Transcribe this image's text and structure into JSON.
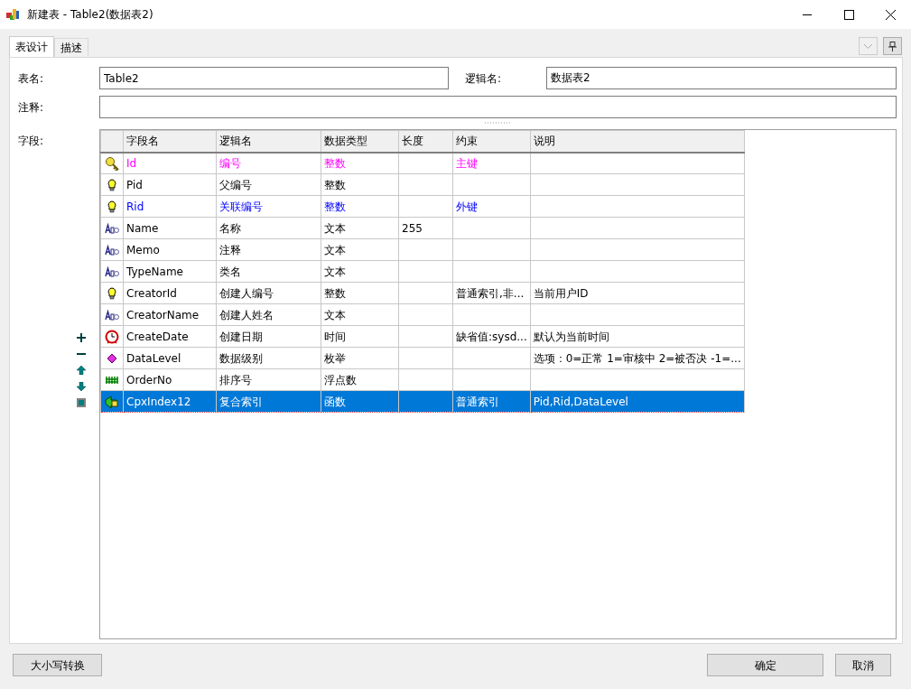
{
  "window": {
    "title": "新建表 - Table2(数据表2)"
  },
  "tabs": [
    {
      "label": "表设计",
      "selected": true
    },
    {
      "label": "描述",
      "selected": false
    }
  ],
  "form": {
    "table_name_label": "表名:",
    "table_name": "Table2",
    "logical_name_label": "逻辑名:",
    "logical_name": "数据表2",
    "comment_label": "注释:",
    "fields_label": "字段:"
  },
  "grid": {
    "columns": [
      "字段名",
      "逻辑名",
      "数据类型",
      "长度",
      "约束",
      "说明"
    ],
    "rows": [
      {
        "kind": "key",
        "color": "#ff00ff",
        "selected": false,
        "name": "Id",
        "logical": "编号",
        "type": "整数",
        "constraint": "主键"
      },
      {
        "kind": "bulb",
        "color": "#000000",
        "selected": false,
        "name": "Pid",
        "logical": "父编号",
        "type": "整数"
      },
      {
        "kind": "bulb",
        "color": "#0000ff",
        "selected": false,
        "name": "Rid",
        "logical": "关联编号",
        "type": "整数",
        "constraint": "外键"
      },
      {
        "kind": "text",
        "color": "#000000",
        "selected": false,
        "name": "Name",
        "logical": "名称",
        "type": "文本",
        "length": "255"
      },
      {
        "kind": "text",
        "color": "#000000",
        "selected": false,
        "name": "Memo",
        "logical": "注释",
        "type": "文本"
      },
      {
        "kind": "text",
        "color": "#000000",
        "selected": false,
        "name": "TypeName",
        "logical": "类名",
        "type": "文本"
      },
      {
        "kind": "bulb",
        "color": "#000000",
        "selected": false,
        "name": "CreatorId",
        "logical": "创建人编号",
        "type": "整数",
        "constraint": "普通索引,非...",
        "description": "当前用户ID"
      },
      {
        "kind": "text",
        "color": "#000000",
        "selected": false,
        "name": "CreatorName",
        "logical": "创建人姓名",
        "type": "文本"
      },
      {
        "kind": "clock",
        "color": "#000000",
        "selected": false,
        "name": "CreateDate",
        "logical": "创建日期",
        "type": "时间",
        "constraint": "缺省值:sysd...",
        "description": "默认为当前时间"
      },
      {
        "kind": "enum",
        "color": "#000000",
        "selected": false,
        "name": "DataLevel",
        "logical": "数据级别",
        "type": "枚举",
        "description": "选项：0=正常 1=审核中 2=被否决 -1=..."
      },
      {
        "kind": "number",
        "color": "#000000",
        "selected": false,
        "name": "OrderNo",
        "logical": "排序号",
        "type": "浮点数"
      },
      {
        "kind": "index",
        "selected": true,
        "name": "CpxIndex12",
        "logical": "复合索引",
        "type": "函数",
        "constraint": "普通索引",
        "description": "Pid,Rid,DataLevel"
      }
    ]
  },
  "buttons": {
    "left": "大小写转换",
    "ok": "确定",
    "cancel": "取消"
  }
}
